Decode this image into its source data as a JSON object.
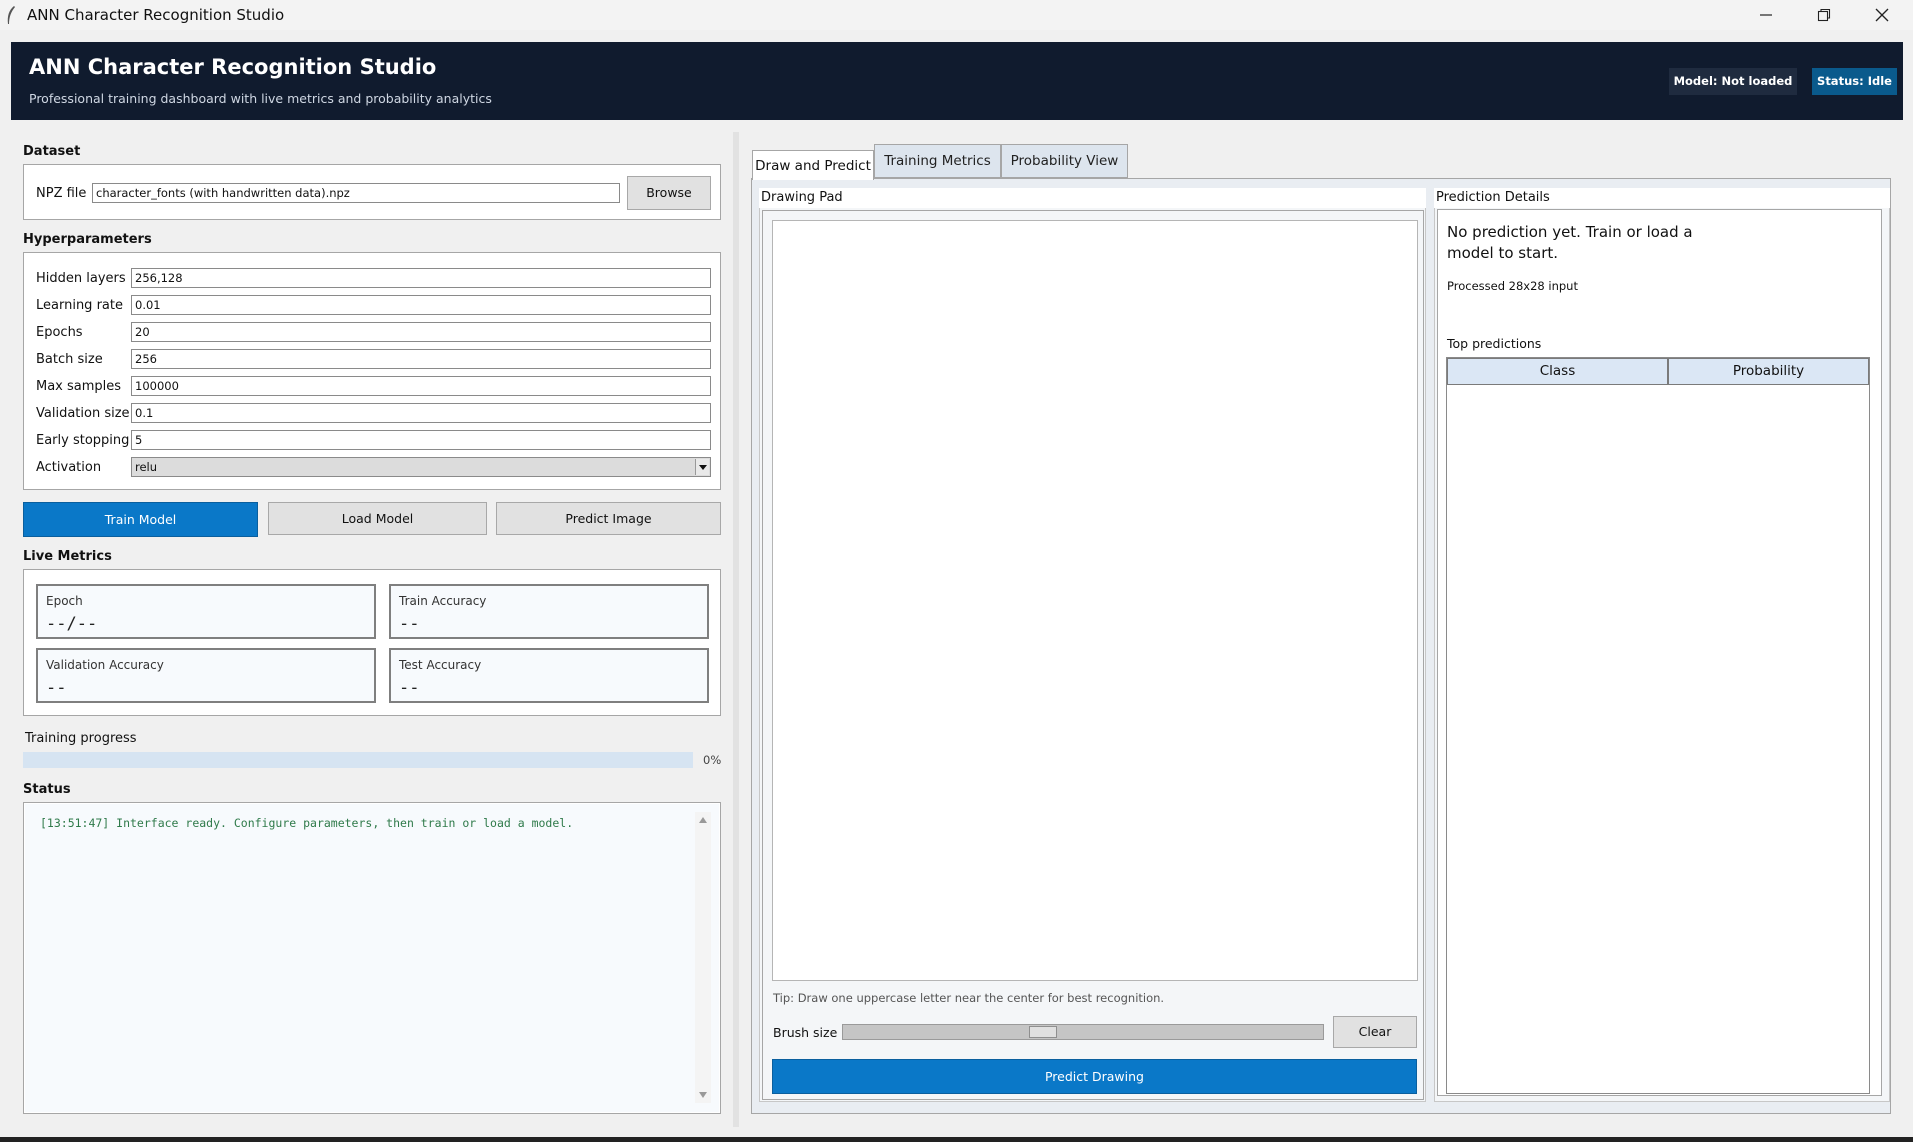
{
  "window": {
    "title": "ANN Character Recognition Studio"
  },
  "header": {
    "title": "ANN Character Recognition Studio",
    "subtitle": "Professional training dashboard with live metrics and probability analytics",
    "model_badge": "Model: Not loaded",
    "status_badge": "Status: Idle"
  },
  "dataset": {
    "section": "Dataset",
    "npz_label": "NPZ file",
    "npz_value": "character_fonts (with handwritten data).npz",
    "browse_label": "Browse"
  },
  "hyperparameters": {
    "section": "Hyperparameters",
    "fields": [
      {
        "label": "Hidden layers",
        "value": "256,128"
      },
      {
        "label": "Learning rate",
        "value": "0.01"
      },
      {
        "label": "Epochs",
        "value": "20"
      },
      {
        "label": "Batch size",
        "value": "256"
      },
      {
        "label": "Max samples",
        "value": "100000"
      },
      {
        "label": "Validation size",
        "value": "0.1"
      },
      {
        "label": "Early stopping",
        "value": "5"
      }
    ],
    "activation_label": "Activation",
    "activation_value": "relu"
  },
  "actions": {
    "train_label": "Train Model",
    "load_label": "Load Model",
    "predict_image_label": "Predict Image"
  },
  "live_metrics": {
    "section": "Live Metrics",
    "cards": [
      {
        "label": "Epoch",
        "value": "--/--"
      },
      {
        "label": "Train Accuracy",
        "value": "--"
      },
      {
        "label": "Validation Accuracy",
        "value": "--"
      },
      {
        "label": "Test Accuracy",
        "value": "--"
      }
    ]
  },
  "progress": {
    "label": "Training progress",
    "percent_text": "0%",
    "fraction": 0
  },
  "status": {
    "section": "Status",
    "log": "[13:51:47] Interface ready. Configure parameters, then train or load a model."
  },
  "tabs": [
    {
      "label": "Draw and Predict",
      "active": true
    },
    {
      "label": "Training Metrics",
      "active": false
    },
    {
      "label": "Probability View",
      "active": false
    }
  ],
  "drawing": {
    "title": "Drawing Pad",
    "tip": "Tip: Draw one uppercase letter near the center for best recognition.",
    "brush_label": "Brush size",
    "clear_label": "Clear",
    "predict_label": "Predict Drawing"
  },
  "prediction": {
    "title": "Prediction Details",
    "message_line1": "No prediction yet. Train or load a",
    "message_line2": "model to start.",
    "processed_label": "Processed 28x28 input",
    "top_label": "Top predictions",
    "columns": [
      "Class",
      "Probability"
    ]
  },
  "colors": {
    "header_bg": "#101b2e",
    "accent": "#0a78c8",
    "status_badge": "#0a5a8c",
    "log_text": "#2f7a4a"
  }
}
